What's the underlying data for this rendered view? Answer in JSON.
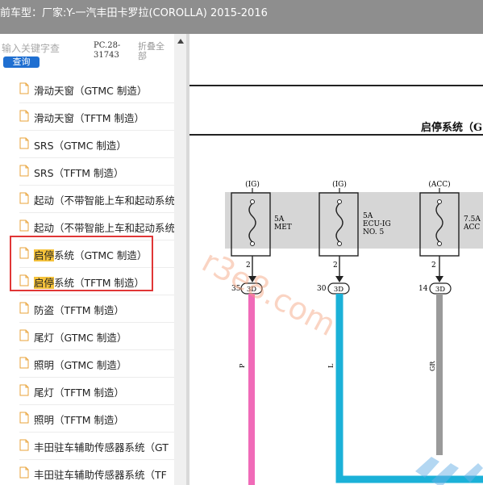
{
  "titlebar": {
    "text": "前车型：厂家:Y-一汽丰田卡罗拉(COROLLA) 2015-2016"
  },
  "search": {
    "placeholder": "输入关键字查",
    "button_label": "查询",
    "pc_code": "PC.28-31743",
    "collapse_label": "折叠全部"
  },
  "list": [
    {
      "label": "滑动天窗（GTMC 制造）"
    },
    {
      "label": "滑动天窗（TFTM 制造）"
    },
    {
      "label": "SRS（GTMC 制造）"
    },
    {
      "label": "SRS（TFTM 制造）"
    },
    {
      "label": "起动（不带智能上车和起动系统"
    },
    {
      "label": "起动（不带智能上车和起动系统"
    },
    {
      "label_hl": "启停",
      "label_rest": "系统（GTMC 制造）"
    },
    {
      "label_hl": "启停",
      "label_rest": "系统（TFTM 制造）"
    },
    {
      "label": "防盗（TFTM 制造）"
    },
    {
      "label": "尾灯（GTMC 制造）"
    },
    {
      "label": "照明（GTMC 制造）"
    },
    {
      "label": "尾灯（TFTM 制造）"
    },
    {
      "label": "照明（TFTM 制造）"
    },
    {
      "label": "丰田驻车辅助传感器系统（GT"
    },
    {
      "label": "丰田驻车辅助传感器系统（TF"
    }
  ],
  "diagram": {
    "system_title": "启停系统（G",
    "fuses": [
      {
        "source": "(IG)",
        "rating_lines": [
          "5A",
          "MET"
        ],
        "pin": "2",
        "connector_pin": "35",
        "connector": "3D",
        "wire_color": "P"
      },
      {
        "source": "(IG)",
        "rating_lines": [
          "5A",
          "ECU-IG",
          "NO. 5"
        ],
        "pin": "2",
        "connector_pin": "30",
        "connector": "3D",
        "wire_color": "L"
      },
      {
        "source": "(ACC)",
        "rating_lines": [
          "7.5A",
          "ACC"
        ],
        "pin": "2",
        "connector_pin": "14",
        "connector": "3D",
        "wire_color": "GR"
      }
    ],
    "watermark": "r3e8.com",
    "colors": {
      "pink": "#f06bb8",
      "cyan": "#1bb1d8",
      "gray": "#9a9a9a",
      "fusebox": "#d6d6d6"
    }
  }
}
